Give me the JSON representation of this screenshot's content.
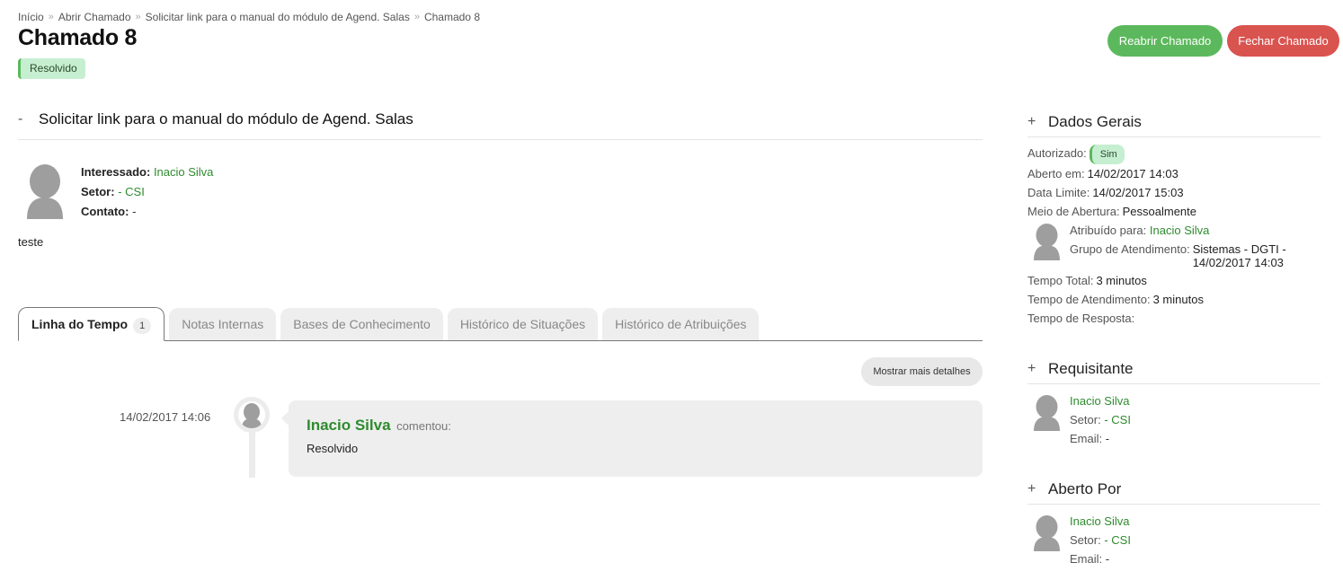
{
  "breadcrumb": [
    "Início",
    "Abrir Chamado",
    "Solicitar link para o manual do módulo de Agend. Salas",
    "Chamado 8"
  ],
  "breadcrumb_separator": "»",
  "page_title": "Chamado 8",
  "status_badge": "Resolvido",
  "actions": {
    "reopen": "Reabrir Chamado",
    "close": "Fechar Chamado"
  },
  "subject": {
    "toggle": "-",
    "title": "Solicitar link para o manual do módulo de Agend. Salas"
  },
  "requester": {
    "interested_label": "Interessado:",
    "interested_value": "Inacio Silva",
    "sector_label": "Setor:",
    "sector_value": "- CSI",
    "contact_label": "Contato:",
    "contact_value": "-"
  },
  "description": "teste",
  "tabs": [
    {
      "label": "Linha do Tempo",
      "count": "1",
      "active": true
    },
    {
      "label": "Notas Internas"
    },
    {
      "label": "Bases de Conhecimento"
    },
    {
      "label": "Histórico de Situações"
    },
    {
      "label": "Histórico de Atribuições"
    }
  ],
  "more_details": "Mostrar mais detalhes",
  "timeline": [
    {
      "date": "14/02/2017 14:06",
      "author": "Inacio Silva",
      "verb": "comentou:",
      "text": "Resolvido"
    }
  ],
  "sidebar": {
    "general": {
      "toggle": "+",
      "title": "Dados Gerais",
      "authorized_label": "Autorizado:",
      "authorized_value": "Sim",
      "opened_label": "Aberto em:",
      "opened_value": "14/02/2017 14:03",
      "deadline_label": "Data Limite:",
      "deadline_value": "14/02/2017 15:03",
      "channel_label": "Meio de Abertura:",
      "channel_value": "Pessoalmente",
      "assigned_label": "Atribuído para:",
      "assigned_value": "Inacio Silva",
      "group_label": "Grupo de Atendimento:",
      "group_value_1": "Sistemas - DGTI -",
      "group_value_2": "14/02/2017 14:03",
      "total_time_label": "Tempo Total:",
      "total_time_value": "3 minutos",
      "service_time_label": "Tempo de Atendimento:",
      "service_time_value": "3 minutos",
      "response_time_label": "Tempo de Resposta:",
      "response_time_value": ""
    },
    "requester": {
      "toggle": "+",
      "title": "Requisitante",
      "name": "Inacio Silva",
      "sector_label": "Setor:",
      "sector_value": "- CSI",
      "email_label": "Email:",
      "email_value": "-"
    },
    "opened_by": {
      "toggle": "+",
      "title": "Aberto Por",
      "name": "Inacio Silva",
      "sector_label": "Setor:",
      "sector_value": "- CSI",
      "email_label": "Email:",
      "email_value": "-"
    }
  },
  "colors": {
    "success": "#5cb85c",
    "danger": "#d9534f",
    "link": "#2e8b2e",
    "badge_bg": "#c6efd1"
  }
}
